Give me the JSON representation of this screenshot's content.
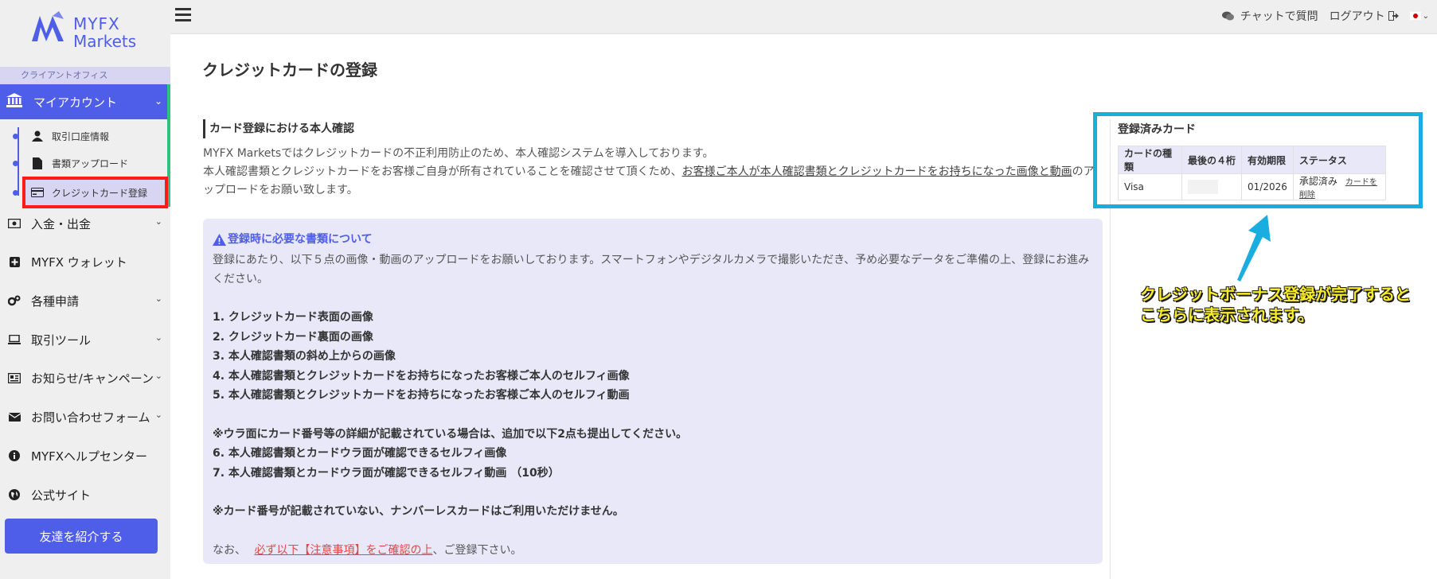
{
  "brand": {
    "line1": "MYFX",
    "line2": "Markets",
    "color": "#4e5ee8"
  },
  "sidebar": {
    "section_label": "クライアントオフィス",
    "my_account": "マイアカウント",
    "sub_items": [
      {
        "label": "取引口座情報",
        "icon": "person-icon"
      },
      {
        "label": "書類アップロード",
        "icon": "document-icon"
      },
      {
        "label": "クレジットカード登録",
        "icon": "credit-card-icon"
      }
    ],
    "items": [
      {
        "label": "入金・出金",
        "icon": "money-icon"
      },
      {
        "label": "MYFX ウォレット",
        "icon": "plus-square-icon"
      },
      {
        "label": "各種申請",
        "icon": "cogs-icon"
      },
      {
        "label": "取引ツール",
        "icon": "laptop-icon"
      },
      {
        "label": "お知らせ/キャンペーン",
        "icon": "newspaper-icon"
      },
      {
        "label": "お問い合わせフォーム",
        "icon": "envelope-icon"
      },
      {
        "label": "MYFXヘルプセンター",
        "icon": "info-icon"
      },
      {
        "label": "公式サイト",
        "icon": "globe-icon"
      }
    ],
    "refer_button": "友達を紹介する"
  },
  "topbar": {
    "chat_label": "チャットで質問",
    "logout_label": "ログアウト"
  },
  "main": {
    "page_title": "クレジットカードの登録",
    "section_title": "カード登録における本人確認",
    "intro_line1": "MYFX Marketsではクレジットカードの不正利用防止のため、本人確認システムを導入しております。",
    "intro_line2a": "本人確認書類とクレジットカードをお客様ご自身が所有されていることを確認させて頂くため、",
    "intro_line2b": "お客様ご本人が本人確認書類とクレジットカードをお持ちになった画像と動画",
    "intro_line2c": "のアップロードをお願い致します。",
    "notice": {
      "heading": "登録時に必要な書類について",
      "desc": "登録にあたり、以下５点の画像・動画のアップロードをお願いしております。スマートフォンやデジタルカメラで撮影いただき、予め必要なデータをご準備の上、登録にお進みください。",
      "list": [
        "1. クレジットカード表面の画像",
        "2. クレジットカード裏面の画像",
        "3. 本人確認書類の斜め上からの画像",
        "4. 本人確認書類とクレジットカードをお持ちになったお客様ご本人のセルフィ画像",
        "5. 本人確認書類とクレジットカードをお持ちになったお客様ご本人のセルフィ動画"
      ],
      "extra_note": "※ウラ面にカード番号等の詳細が記載されている場合は、追加で以下2点も提出してください。",
      "extra_list": [
        "6. 本人確認書類とカードウラ面が確認できるセルフィ画像",
        "7. 本人確認書類とカードウラ面が確認できるセルフィ動画 （10秒）"
      ],
      "numberless_note": "※カード番号が記載されていない、ナンバーレスカードはご利用いただけません。",
      "footer_prefix": "なお、",
      "footer_link": "必ず以下【注意事項】をご確認の上",
      "footer_suffix": "、ご登録下さい。"
    }
  },
  "cards_panel": {
    "title": "登録済みカード",
    "headers": [
      "カードの種類",
      "最後の４桁",
      "有効期限",
      "ステータス"
    ],
    "row": {
      "type": "Visa",
      "last4": "",
      "expiry": "01/2026",
      "status": "承認済み",
      "delete_link": "カードを削除"
    }
  },
  "annotation": {
    "line1": "クレジットボーナス登録が完了すると",
    "line2": "こちらに表示されます。"
  }
}
